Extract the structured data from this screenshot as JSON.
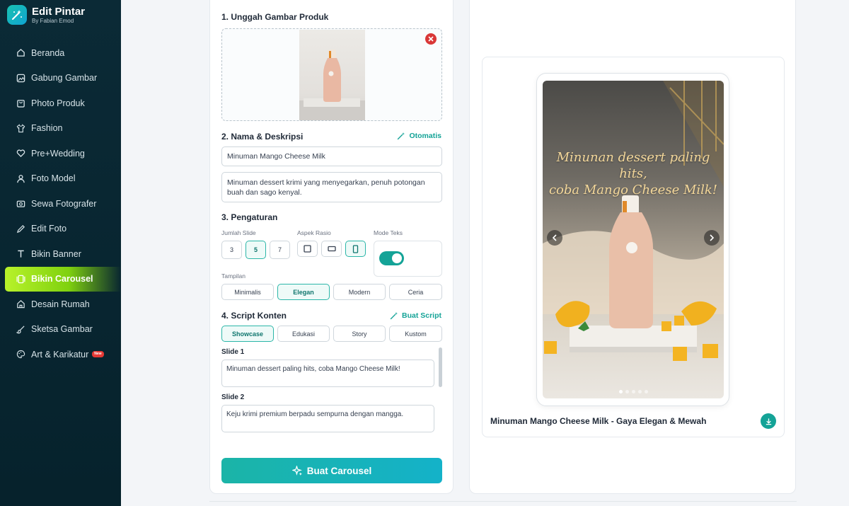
{
  "brand": {
    "title": "Edit Pintar",
    "subtitle": "By Fabian Emod"
  },
  "sidebar": {
    "items": [
      {
        "label": "Beranda",
        "icon": "home-icon"
      },
      {
        "label": "Gabung Gambar",
        "icon": "image-icon"
      },
      {
        "label": "Photo Produk",
        "icon": "bag-icon"
      },
      {
        "label": "Fashion",
        "icon": "shirt-icon"
      },
      {
        "label": "Pre+Wedding",
        "icon": "heart-icon"
      },
      {
        "label": "Foto Model",
        "icon": "user-icon"
      },
      {
        "label": "Sewa Fotografer",
        "icon": "camera-icon"
      },
      {
        "label": "Edit Foto",
        "icon": "pencil-icon"
      },
      {
        "label": "Bikin Banner",
        "icon": "text-icon"
      },
      {
        "label": "Bikin Carousel",
        "icon": "carousel-icon",
        "active": true
      },
      {
        "label": "Desain Rumah",
        "icon": "house-icon"
      },
      {
        "label": "Sketsa Gambar",
        "icon": "brush-icon"
      },
      {
        "label": "Art & Karikatur",
        "icon": "palette-icon",
        "badge": "New"
      }
    ],
    "accent": "#a8ec1f"
  },
  "form": {
    "section1": {
      "title": "1. Unggah Gambar Produk"
    },
    "section2": {
      "title": "2. Nama & Deskripsi",
      "action": "Otomatis",
      "name_value": "Minuman Mango Cheese Milk",
      "desc_value": "Minuman dessert krimi yang menyegarkan, penuh potongan buah dan sago kenyal."
    },
    "section3": {
      "title": "3. Pengaturan",
      "slide_label": "Jumlah Slide",
      "slide_options": [
        "3",
        "5",
        "7"
      ],
      "slide_selected": "5",
      "ratio_label": "Aspek Rasio",
      "text_mode_label": "Mode Teks",
      "text_mode_on": true,
      "style_label": "Tampilan",
      "style_options": [
        "Minimalis",
        "Elegan",
        "Modern",
        "Ceria"
      ],
      "style_selected": "Elegan"
    },
    "section4": {
      "title": "4. Script Konten",
      "action": "Buat Script",
      "tabs": [
        "Showcase",
        "Edukasi",
        "Story",
        "Kustom"
      ],
      "tab_selected": "Showcase",
      "slides": [
        {
          "label": "Slide 1",
          "text": "Minuman dessert paling hits, coba Mango Cheese Milk!"
        },
        {
          "label": "Slide 2",
          "text": "Keju krimi premium berpadu sempurna dengan mangga."
        }
      ]
    },
    "submit_label": "Buat Carousel"
  },
  "preview": {
    "overlay_line1": "Minunan dessert paling hits,",
    "overlay_line2": "coba Mango Cheese Milk!",
    "caption": "Minuman Mango Cheese Milk - Gaya Elegan & Mewah",
    "dot_count": 5,
    "active_dot": 1
  },
  "colors": {
    "primary": "#14a397",
    "sidebar_bg": "#0b2a36",
    "danger": "#d93737"
  }
}
